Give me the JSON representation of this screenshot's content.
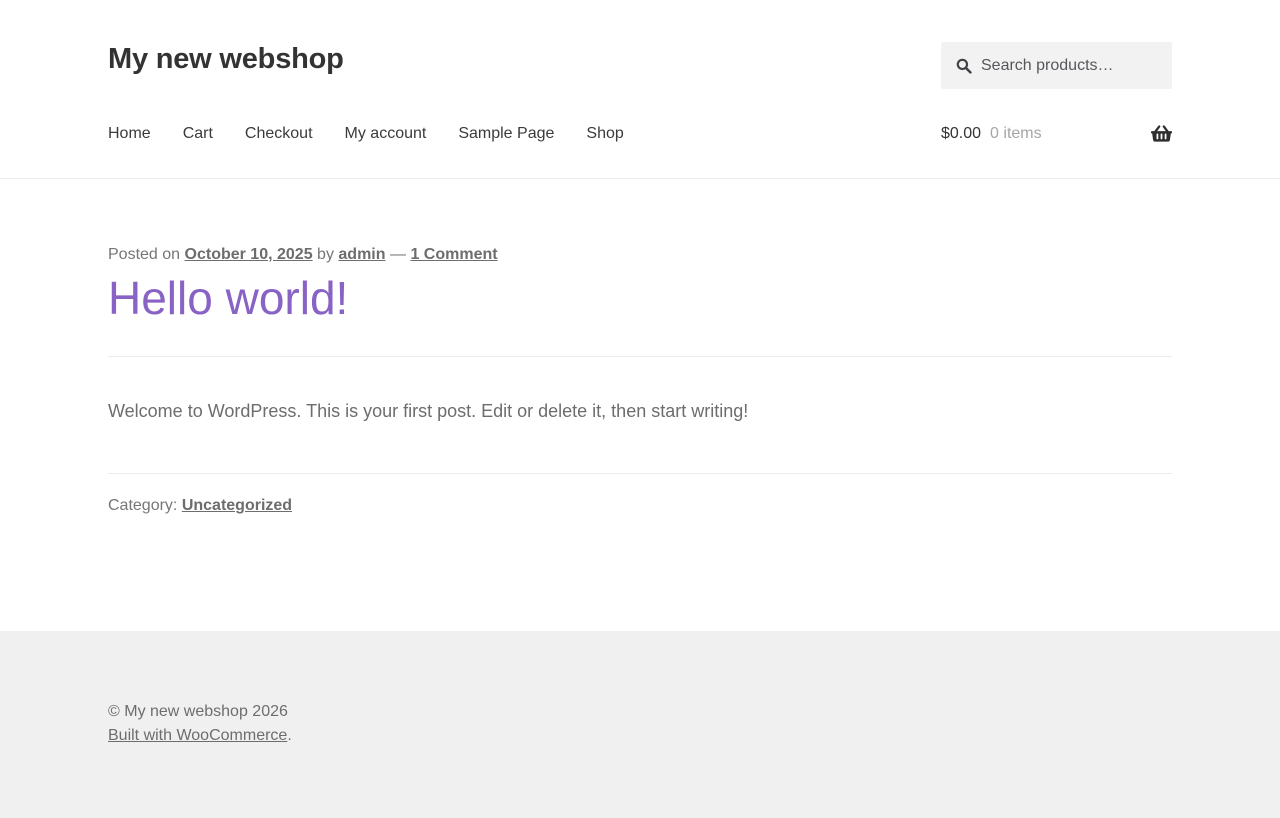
{
  "header": {
    "site_title": "My new webshop",
    "search": {
      "placeholder": "Search products…"
    },
    "nav": {
      "items": [
        "Home",
        "Cart",
        "Checkout",
        "My account",
        "Sample Page",
        "Shop"
      ]
    },
    "cart": {
      "total": "$0.00",
      "count": "0 items"
    }
  },
  "post": {
    "meta": {
      "posted_on_label": "Posted on",
      "date": "October 10, 2025",
      "by_label": "by",
      "author": "admin",
      "separator": "—",
      "comments": "1 Comment"
    },
    "title": "Hello world!",
    "content": "Welcome to WordPress. This is your first post. Edit or delete it, then start writing!",
    "category_label": "Category:",
    "category": "Uncategorized"
  },
  "footer": {
    "copyright": "© My new webshop 2026",
    "credit_link": "Built with WooCommerce",
    "credit_suffix": "."
  },
  "colors": {
    "accent_purple": "#8862c5",
    "footer_bg": "#f0f0f0",
    "text_dark": "#333333",
    "text_gray": "#6d6d6d"
  }
}
